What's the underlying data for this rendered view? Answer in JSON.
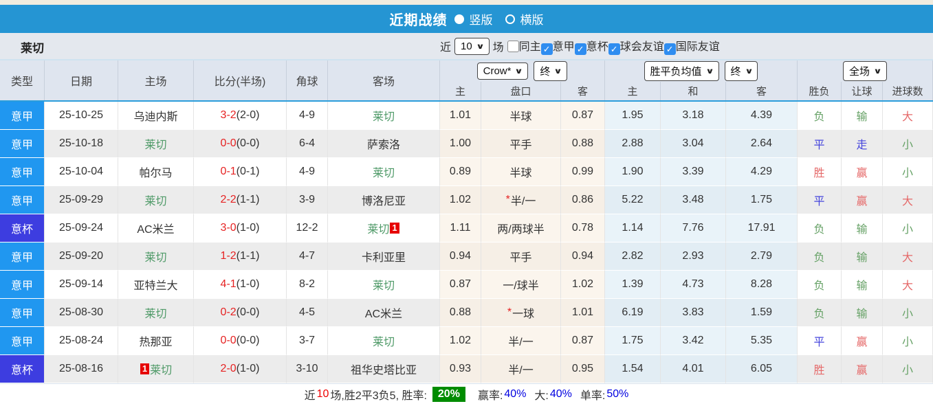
{
  "titlebar": {
    "title": "近期战绩",
    "radio_selected": "竖版",
    "radio_unselected": "横版"
  },
  "filter": {
    "team": "莱切",
    "near_label": "近",
    "count": "10",
    "games_label": "场",
    "checkboxes": [
      {
        "label": "同主",
        "checked": false
      },
      {
        "label": "意甲",
        "checked": true
      },
      {
        "label": "意杯",
        "checked": true
      },
      {
        "label": "球会友谊",
        "checked": true
      },
      {
        "label": "国际友谊",
        "checked": true
      }
    ]
  },
  "table": {
    "headers": {
      "type": "类型",
      "date": "日期",
      "home": "主场",
      "score": "比分(半场)",
      "corners": "角球",
      "away": "客场"
    },
    "selects": {
      "company": "Crow*",
      "company_period": "终",
      "avg": "胜平负均值",
      "avg_period": "终",
      "scope": "全场"
    },
    "subheaders": [
      "主",
      "盘口",
      "客",
      "主",
      "和",
      "客",
      "胜负",
      "让球",
      "进球数"
    ],
    "rows": [
      {
        "type": "意甲",
        "cup": false,
        "date": "25-10-25",
        "home": {
          "name": "乌迪内斯",
          "lecce": false,
          "badge": null,
          "badge_pos": null
        },
        "score": "3-2",
        "half": "(2-0)",
        "corners": "4-9",
        "away": {
          "name": "莱切",
          "lecce": true,
          "badge": null,
          "badge_pos": null
        },
        "odds": {
          "home": "1.01",
          "line": "半球",
          "star": false,
          "away": "0.87"
        },
        "avg": {
          "win": "1.95",
          "draw": "3.18",
          "lose": "4.39"
        },
        "result": {
          "text": "负",
          "color": "green"
        },
        "handicap_result": {
          "text": "输",
          "color": "green"
        },
        "goals": {
          "text": "大",
          "color": "red"
        }
      },
      {
        "type": "意甲",
        "cup": false,
        "date": "25-10-18",
        "home": {
          "name": "莱切",
          "lecce": true,
          "badge": null,
          "badge_pos": null
        },
        "score": "0-0",
        "half": "(0-0)",
        "corners": "6-4",
        "away": {
          "name": "萨索洛",
          "lecce": false,
          "badge": null,
          "badge_pos": null
        },
        "odds": {
          "home": "1.00",
          "line": "平手",
          "star": false,
          "away": "0.88"
        },
        "avg": {
          "win": "2.88",
          "draw": "3.04",
          "lose": "2.64"
        },
        "result": {
          "text": "平",
          "color": "blue"
        },
        "handicap_result": {
          "text": "走",
          "color": "blue"
        },
        "goals": {
          "text": "小",
          "color": "green"
        }
      },
      {
        "type": "意甲",
        "cup": false,
        "date": "25-10-04",
        "home": {
          "name": "帕尔马",
          "lecce": false,
          "badge": null,
          "badge_pos": null
        },
        "score": "0-1",
        "half": "(0-1)",
        "corners": "4-9",
        "away": {
          "name": "莱切",
          "lecce": true,
          "badge": null,
          "badge_pos": null
        },
        "odds": {
          "home": "0.89",
          "line": "半球",
          "star": false,
          "away": "0.99"
        },
        "avg": {
          "win": "1.90",
          "draw": "3.39",
          "lose": "4.29"
        },
        "result": {
          "text": "胜",
          "color": "red"
        },
        "handicap_result": {
          "text": "赢",
          "color": "red"
        },
        "goals": {
          "text": "小",
          "color": "green"
        }
      },
      {
        "type": "意甲",
        "cup": false,
        "date": "25-09-29",
        "home": {
          "name": "莱切",
          "lecce": true,
          "badge": null,
          "badge_pos": null
        },
        "score": "2-2",
        "half": "(1-1)",
        "corners": "3-9",
        "away": {
          "name": "博洛尼亚",
          "lecce": false,
          "badge": null,
          "badge_pos": null
        },
        "odds": {
          "home": "1.02",
          "line": "半/一",
          "star": true,
          "away": "0.86"
        },
        "avg": {
          "win": "5.22",
          "draw": "3.48",
          "lose": "1.75"
        },
        "result": {
          "text": "平",
          "color": "blue"
        },
        "handicap_result": {
          "text": "赢",
          "color": "red"
        },
        "goals": {
          "text": "大",
          "color": "red"
        }
      },
      {
        "type": "意杯",
        "cup": true,
        "date": "25-09-24",
        "home": {
          "name": "AC米兰",
          "lecce": false,
          "badge": null,
          "badge_pos": null
        },
        "score": "3-0",
        "half": "(1-0)",
        "corners": "12-2",
        "away": {
          "name": "莱切",
          "lecce": true,
          "badge": "1",
          "badge_pos": "after"
        },
        "odds": {
          "home": "1.11",
          "line": "两/两球半",
          "star": false,
          "away": "0.78"
        },
        "avg": {
          "win": "1.14",
          "draw": "7.76",
          "lose": "17.91"
        },
        "result": {
          "text": "负",
          "color": "green"
        },
        "handicap_result": {
          "text": "输",
          "color": "green"
        },
        "goals": {
          "text": "小",
          "color": "green"
        }
      },
      {
        "type": "意甲",
        "cup": false,
        "date": "25-09-20",
        "home": {
          "name": "莱切",
          "lecce": true,
          "badge": null,
          "badge_pos": null
        },
        "score": "1-2",
        "half": "(1-1)",
        "corners": "4-7",
        "away": {
          "name": "卡利亚里",
          "lecce": false,
          "badge": null,
          "badge_pos": null
        },
        "odds": {
          "home": "0.94",
          "line": "平手",
          "star": false,
          "away": "0.94"
        },
        "avg": {
          "win": "2.82",
          "draw": "2.93",
          "lose": "2.79"
        },
        "result": {
          "text": "负",
          "color": "green"
        },
        "handicap_result": {
          "text": "输",
          "color": "green"
        },
        "goals": {
          "text": "大",
          "color": "red"
        }
      },
      {
        "type": "意甲",
        "cup": false,
        "date": "25-09-14",
        "home": {
          "name": "亚特兰大",
          "lecce": false,
          "badge": null,
          "badge_pos": null
        },
        "score": "4-1",
        "half": "(1-0)",
        "corners": "8-2",
        "away": {
          "name": "莱切",
          "lecce": true,
          "badge": null,
          "badge_pos": null
        },
        "odds": {
          "home": "0.87",
          "line": "一/球半",
          "star": false,
          "away": "1.02"
        },
        "avg": {
          "win": "1.39",
          "draw": "4.73",
          "lose": "8.28"
        },
        "result": {
          "text": "负",
          "color": "green"
        },
        "handicap_result": {
          "text": "输",
          "color": "green"
        },
        "goals": {
          "text": "大",
          "color": "red"
        }
      },
      {
        "type": "意甲",
        "cup": false,
        "date": "25-08-30",
        "home": {
          "name": "莱切",
          "lecce": true,
          "badge": null,
          "badge_pos": null
        },
        "score": "0-2",
        "half": "(0-0)",
        "corners": "4-5",
        "away": {
          "name": "AC米兰",
          "lecce": false,
          "badge": null,
          "badge_pos": null
        },
        "odds": {
          "home": "0.88",
          "line": "一球",
          "star": true,
          "away": "1.01"
        },
        "avg": {
          "win": "6.19",
          "draw": "3.83",
          "lose": "1.59"
        },
        "result": {
          "text": "负",
          "color": "green"
        },
        "handicap_result": {
          "text": "输",
          "color": "green"
        },
        "goals": {
          "text": "小",
          "color": "green"
        }
      },
      {
        "type": "意甲",
        "cup": false,
        "date": "25-08-24",
        "home": {
          "name": "热那亚",
          "lecce": false,
          "badge": null,
          "badge_pos": null
        },
        "score": "0-0",
        "half": "(0-0)",
        "corners": "3-7",
        "away": {
          "name": "莱切",
          "lecce": true,
          "badge": null,
          "badge_pos": null
        },
        "odds": {
          "home": "1.02",
          "line": "半/一",
          "star": false,
          "away": "0.87"
        },
        "avg": {
          "win": "1.75",
          "draw": "3.42",
          "lose": "5.35"
        },
        "result": {
          "text": "平",
          "color": "blue"
        },
        "handicap_result": {
          "text": "赢",
          "color": "red"
        },
        "goals": {
          "text": "小",
          "color": "green"
        }
      },
      {
        "type": "意杯",
        "cup": true,
        "date": "25-08-16",
        "home": {
          "name": "莱切",
          "lecce": true,
          "badge": "1",
          "badge_pos": "before"
        },
        "score": "2-0",
        "half": "(1-0)",
        "corners": "3-10",
        "away": {
          "name": "祖华史塔比亚",
          "lecce": false,
          "badge": null,
          "badge_pos": null
        },
        "odds": {
          "home": "0.93",
          "line": "半/一",
          "star": false,
          "away": "0.95"
        },
        "avg": {
          "win": "1.54",
          "draw": "4.01",
          "lose": "6.05"
        },
        "result": {
          "text": "胜",
          "color": "red"
        },
        "handicap_result": {
          "text": "赢",
          "color": "red"
        },
        "goals": {
          "text": "小",
          "color": "green"
        }
      }
    ]
  },
  "summary": {
    "p1": "近",
    "count": "10",
    "p2": "场,胜2平3负5, 胜率:",
    "rate": "20%",
    "l1": "赢率:",
    "v1": "40%",
    "l2": "大:",
    "v2": "40%",
    "l3": "单率:",
    "v3": "50%"
  },
  "colors": {
    "titlebar_blue": "#2595d3",
    "league_a_blue": "#2097f0",
    "league_cup_indigo": "#3d3de0",
    "win_red": "#e56969",
    "draw_blue": "#4545dd",
    "lose_green": "#67a267",
    "score_red": "#e62222",
    "lecce_green": "#4f9a68",
    "rate_badge_green": "#008c00",
    "stat_blue": "#0000e0",
    "checkbox_blue": "#2f8df0"
  }
}
